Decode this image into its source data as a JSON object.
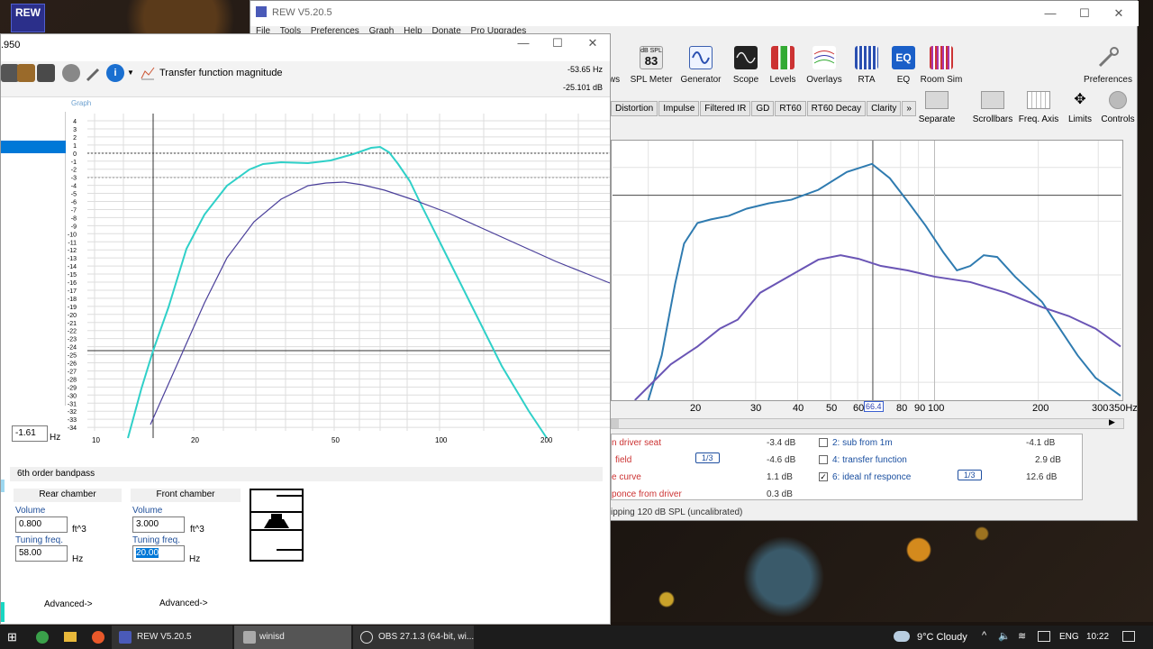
{
  "desktop": {
    "rew_icon_label": "REW"
  },
  "rew": {
    "title": "REW V5.20.5",
    "menu": [
      "File",
      "Tools",
      "Preferences",
      "Graph",
      "Help",
      "Donate",
      "Pro Upgrades"
    ],
    "toolbar": [
      {
        "label": "ws",
        "icon": "views-icon"
      },
      {
        "label": "SPL Meter",
        "icon": "spl-meter-icon",
        "badge_top": "dB SPL",
        "badge_value": "83"
      },
      {
        "label": "Generator",
        "icon": "generator-icon"
      },
      {
        "label": "Scope",
        "icon": "scope-icon"
      },
      {
        "label": "Levels",
        "icon": "levels-icon"
      },
      {
        "label": "Overlays",
        "icon": "overlays-icon"
      },
      {
        "label": "RTA",
        "icon": "rta-icon"
      },
      {
        "label": "EQ",
        "icon": "eq-icon"
      },
      {
        "label": "Room Sim",
        "icon": "room-sim-icon"
      },
      {
        "label": "Preferences",
        "icon": "preferences-icon"
      }
    ],
    "secondary_toolbar": [
      {
        "label": "Separate",
        "icon": "separate-icon"
      },
      {
        "label": "Scrollbars",
        "icon": "scrollbars-icon"
      },
      {
        "label": "Freq. Axis",
        "icon": "freq-axis-icon"
      },
      {
        "label": "Limits",
        "icon": "limits-icon"
      },
      {
        "label": "Controls",
        "icon": "controls-icon"
      }
    ],
    "tabs": [
      "Distortion",
      "Impulse",
      "Filtered IR",
      "GD",
      "RT60",
      "RT60 Decay",
      "Clarity",
      "»"
    ],
    "xaxis_ticks": [
      "20",
      "30",
      "40",
      "50",
      "60",
      "66.4",
      "80",
      "90",
      "100",
      "200",
      "300",
      "350Hz"
    ],
    "cursor_freq": "66.4",
    "legend_left": [
      {
        "text": "n driver seat",
        "value": "-3.4 dB"
      },
      {
        "text": "field",
        "value": "-4.6 dB"
      },
      {
        "text": "e curve",
        "value": "1.1 dB"
      },
      {
        "text": "ponce from driver",
        "value": "0.3 dB"
      }
    ],
    "legend_right": [
      {
        "text": "2: sub from 1m",
        "value": "-4.1 dB",
        "checked": false
      },
      {
        "text": "4: transfer function",
        "value": "2.9 dB",
        "checked": false
      },
      {
        "text": "6: ideal nf responce",
        "value": "12.6 dB",
        "checked": true
      }
    ],
    "smoothing_label": "1/3",
    "status": "ipping 120 dB SPL (uncalibrated)",
    "colors": {
      "series_blue": "#2f7bb0",
      "series_purple": "#6a55b5"
    }
  },
  "winisd": {
    "title": ".950",
    "plot_title": "Transfer function magnitude",
    "readout_freq": "-53.65 Hz",
    "readout_db": "-25.101 dB",
    "graph_label": "Graph",
    "y_ticks": [
      "4",
      "3",
      "2",
      "1",
      "0",
      "-1",
      "-2",
      "-3",
      "-4",
      "-5",
      "-6",
      "-7",
      "-8",
      "-9",
      "-10",
      "-11",
      "-12",
      "-13",
      "-14",
      "-15",
      "-16",
      "-17",
      "-18",
      "-19",
      "-20",
      "-21",
      "-22",
      "-23",
      "-24",
      "-25",
      "-26",
      "-27",
      "-28",
      "-29",
      "-30",
      "-31",
      "-32",
      "-33",
      "-34"
    ],
    "x_ticks": [
      "10",
      "20",
      "50",
      "100",
      "200"
    ],
    "hz_value": "-1.61",
    "hz_unit": "Hz",
    "box_type": "6th order bandpass",
    "rear": {
      "header": "Rear chamber",
      "volume_label": "Volume",
      "volume": "0.800",
      "volume_unit": "ft^3",
      "tuning_label": "Tuning freq.",
      "tuning": "58.00",
      "tuning_unit": "Hz",
      "advanced": "Advanced->"
    },
    "front": {
      "header": "Front chamber",
      "volume_label": "Volume",
      "volume": "3.000",
      "volume_unit": "ft^3",
      "tuning_label": "Tuning freq.",
      "tuning": "20.00",
      "tuning_unit": "Hz",
      "advanced": "Advanced->"
    },
    "colors": {
      "cyan": "#2fd0c8",
      "navy": "#4a3f9a"
    }
  },
  "taskbar": {
    "items": [
      {
        "label": "REW V5.20.5",
        "icon": "rew-app-icon"
      },
      {
        "label": "winisd",
        "icon": "winisd-app-icon"
      },
      {
        "label": "OBS 27.1.3 (64-bit, wi...",
        "icon": "obs-app-icon"
      }
    ],
    "weather": "9°C  Cloudy",
    "lang": "ENG",
    "time": "10:22"
  }
}
